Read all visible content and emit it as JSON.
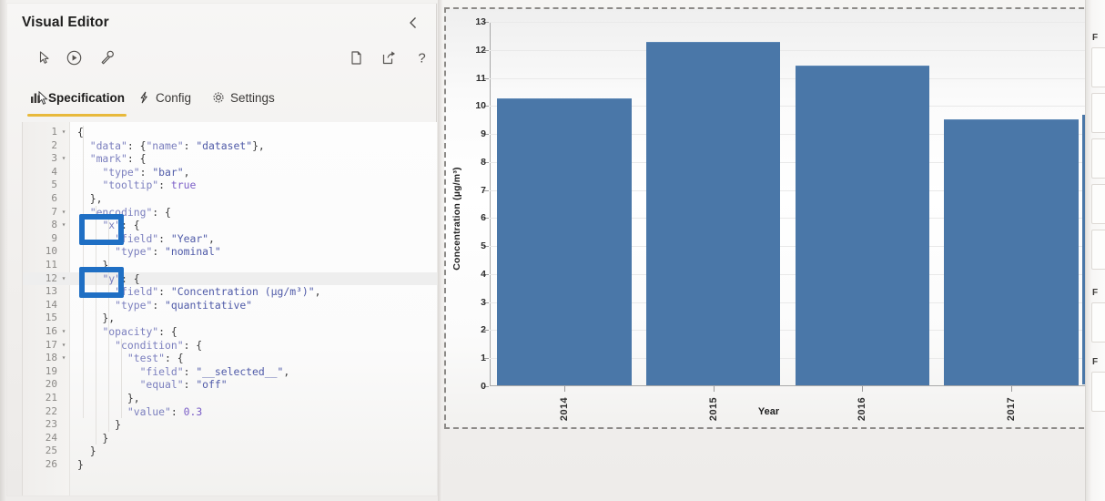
{
  "editor": {
    "title": "Visual Editor",
    "collapse_icon": "chevron-left-icon",
    "toolbar": [
      {
        "name": "pointer-select",
        "icon": "pointer-icon"
      },
      {
        "name": "auto-apply",
        "icon": "circled-play-icon"
      },
      {
        "name": "theme-wrench",
        "icon": "wrench-icon"
      },
      {
        "name": "new-specification",
        "icon": "page-icon"
      },
      {
        "name": "export-specification",
        "icon": "export-icon"
      },
      {
        "name": "help",
        "icon": "question-mark-icon"
      }
    ],
    "tabs": [
      {
        "label": "Specification",
        "icon": "bar-chart-icon",
        "active": true
      },
      {
        "label": "Config",
        "icon": "lightning-icon",
        "active": false
      },
      {
        "label": "Settings",
        "icon": "gear-icon",
        "active": false
      }
    ],
    "accent_color": "#e8b93b",
    "annotation_color": "#1f6fc4",
    "annotations": [
      {
        "name": "highlight-x-encoding",
        "target": "\"x\":"
      },
      {
        "name": "highlight-y-encoding",
        "target": "\"y\":"
      }
    ],
    "active_line": 12,
    "code_lines": [
      {
        "n": 1,
        "fold": true,
        "tokens": [
          {
            "t": "{",
            "c": "p"
          }
        ]
      },
      {
        "n": 2,
        "fold": false,
        "tokens": [
          {
            "t": "  ",
            "c": "p"
          },
          {
            "t": "\"data\"",
            "c": "k"
          },
          {
            "t": ": {",
            "c": "p"
          },
          {
            "t": "\"name\"",
            "c": "k"
          },
          {
            "t": ": ",
            "c": "p"
          },
          {
            "t": "\"dataset\"",
            "c": "s"
          },
          {
            "t": "},",
            "c": "p"
          }
        ]
      },
      {
        "n": 3,
        "fold": true,
        "tokens": [
          {
            "t": "  ",
            "c": "p"
          },
          {
            "t": "\"mark\"",
            "c": "k"
          },
          {
            "t": ": {",
            "c": "p"
          }
        ]
      },
      {
        "n": 4,
        "fold": false,
        "tokens": [
          {
            "t": "    ",
            "c": "p"
          },
          {
            "t": "\"type\"",
            "c": "k"
          },
          {
            "t": ": ",
            "c": "p"
          },
          {
            "t": "\"bar\"",
            "c": "s"
          },
          {
            "t": ",",
            "c": "p"
          }
        ]
      },
      {
        "n": 5,
        "fold": false,
        "tokens": [
          {
            "t": "    ",
            "c": "p"
          },
          {
            "t": "\"tooltip\"",
            "c": "k"
          },
          {
            "t": ": ",
            "c": "p"
          },
          {
            "t": "true",
            "c": "b"
          }
        ]
      },
      {
        "n": 6,
        "fold": false,
        "tokens": [
          {
            "t": "  },",
            "c": "p"
          }
        ]
      },
      {
        "n": 7,
        "fold": true,
        "tokens": [
          {
            "t": "  ",
            "c": "p"
          },
          {
            "t": "\"encoding\"",
            "c": "k"
          },
          {
            "t": ": {",
            "c": "p"
          }
        ]
      },
      {
        "n": 8,
        "fold": true,
        "tokens": [
          {
            "t": "    ",
            "c": "p"
          },
          {
            "t": "\"x\"",
            "c": "k"
          },
          {
            "t": ": {",
            "c": "p"
          }
        ]
      },
      {
        "n": 9,
        "fold": false,
        "tokens": [
          {
            "t": "      ",
            "c": "p"
          },
          {
            "t": "\"field\"",
            "c": "k"
          },
          {
            "t": ": ",
            "c": "p"
          },
          {
            "t": "\"Year\"",
            "c": "s"
          },
          {
            "t": ",",
            "c": "p"
          }
        ]
      },
      {
        "n": 10,
        "fold": false,
        "tokens": [
          {
            "t": "      ",
            "c": "p"
          },
          {
            "t": "\"type\"",
            "c": "k"
          },
          {
            "t": ": ",
            "c": "p"
          },
          {
            "t": "\"nominal\"",
            "c": "s"
          }
        ]
      },
      {
        "n": 11,
        "fold": false,
        "tokens": [
          {
            "t": "    },",
            "c": "p"
          }
        ]
      },
      {
        "n": 12,
        "fold": true,
        "tokens": [
          {
            "t": "    ",
            "c": "p"
          },
          {
            "t": "\"y\"",
            "c": "k"
          },
          {
            "t": ": {",
            "c": "p"
          }
        ]
      },
      {
        "n": 13,
        "fold": false,
        "tokens": [
          {
            "t": "      ",
            "c": "p"
          },
          {
            "t": "\"field\"",
            "c": "k"
          },
          {
            "t": ": ",
            "c": "p"
          },
          {
            "t": "\"Concentration (µg/m³)\"",
            "c": "s"
          },
          {
            "t": ",",
            "c": "p"
          }
        ]
      },
      {
        "n": 14,
        "fold": false,
        "tokens": [
          {
            "t": "      ",
            "c": "p"
          },
          {
            "t": "\"type\"",
            "c": "k"
          },
          {
            "t": ": ",
            "c": "p"
          },
          {
            "t": "\"quantitative\"",
            "c": "s"
          }
        ]
      },
      {
        "n": 15,
        "fold": false,
        "tokens": [
          {
            "t": "    },",
            "c": "p"
          }
        ]
      },
      {
        "n": 16,
        "fold": true,
        "tokens": [
          {
            "t": "    ",
            "c": "p"
          },
          {
            "t": "\"opacity\"",
            "c": "k"
          },
          {
            "t": ": {",
            "c": "p"
          }
        ]
      },
      {
        "n": 17,
        "fold": true,
        "tokens": [
          {
            "t": "      ",
            "c": "p"
          },
          {
            "t": "\"condition\"",
            "c": "k"
          },
          {
            "t": ": {",
            "c": "p"
          }
        ]
      },
      {
        "n": 18,
        "fold": true,
        "tokens": [
          {
            "t": "        ",
            "c": "p"
          },
          {
            "t": "\"test\"",
            "c": "k"
          },
          {
            "t": ": {",
            "c": "p"
          }
        ]
      },
      {
        "n": 19,
        "fold": false,
        "tokens": [
          {
            "t": "          ",
            "c": "p"
          },
          {
            "t": "\"field\"",
            "c": "k"
          },
          {
            "t": ": ",
            "c": "p"
          },
          {
            "t": "\"__selected__\"",
            "c": "s"
          },
          {
            "t": ",",
            "c": "p"
          }
        ]
      },
      {
        "n": 20,
        "fold": false,
        "tokens": [
          {
            "t": "          ",
            "c": "p"
          },
          {
            "t": "\"equal\"",
            "c": "k"
          },
          {
            "t": ": ",
            "c": "p"
          },
          {
            "t": "\"off\"",
            "c": "s"
          }
        ]
      },
      {
        "n": 21,
        "fold": false,
        "tokens": [
          {
            "t": "        },",
            "c": "p"
          }
        ]
      },
      {
        "n": 22,
        "fold": false,
        "tokens": [
          {
            "t": "        ",
            "c": "p"
          },
          {
            "t": "\"value\"",
            "c": "k"
          },
          {
            "t": ": ",
            "c": "p"
          },
          {
            "t": "0.3",
            "c": "b"
          }
        ]
      },
      {
        "n": 23,
        "fold": false,
        "tokens": [
          {
            "t": "      }",
            "c": "p"
          }
        ]
      },
      {
        "n": 24,
        "fold": false,
        "tokens": [
          {
            "t": "    }",
            "c": "p"
          }
        ]
      },
      {
        "n": 25,
        "fold": false,
        "tokens": [
          {
            "t": "  }",
            "c": "p"
          }
        ]
      },
      {
        "n": 26,
        "fold": false,
        "tokens": [
          {
            "t": "}",
            "c": "p"
          }
        ]
      }
    ]
  },
  "chart_data": {
    "type": "bar",
    "title": "",
    "categories": [
      "2014",
      "2015",
      "2016",
      "2017"
    ],
    "values": [
      10.25,
      12.25,
      11.4,
      9.5
    ],
    "series": [
      {
        "name": "Concentration (µg/m³)",
        "values": [
          10.25,
          12.25,
          11.4,
          9.5
        ]
      }
    ],
    "xlabel": "Year",
    "ylabel": "Concentration (µg/m³)",
    "ylim": [
      0,
      13
    ],
    "yticks": [
      0,
      1,
      2,
      3,
      4,
      5,
      6,
      7,
      8,
      9,
      10,
      11,
      12,
      13
    ],
    "grid": true,
    "legend": "none",
    "bar_color": "#4a77a8",
    "selected": true
  },
  "side_pane": {
    "sections": [
      "F",
      "F",
      "F"
    ]
  }
}
